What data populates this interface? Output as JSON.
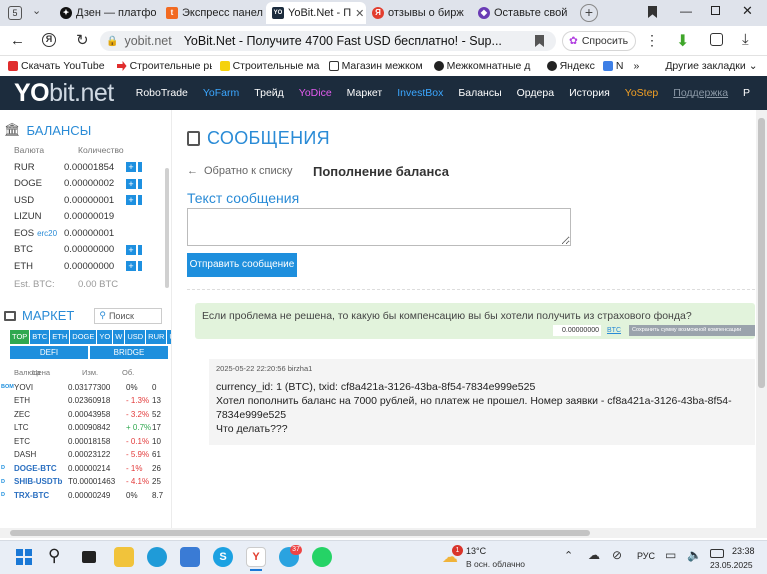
{
  "browser": {
    "tab_count": "5",
    "tabs": [
      {
        "label": "Дзен — платфо"
      },
      {
        "label": "Экспресс панел"
      },
      {
        "label": "YoBit.Net - П"
      },
      {
        "label": "отзывы о бирж"
      },
      {
        "label": "Оставьте свой"
      }
    ],
    "url": "yobit.net",
    "page_title": "YoBit.Net - Получите 4700 Fast USD бесплатно! - Sup...",
    "ask_button": "Спросить",
    "bookmarks": [
      "Скачать YouTube",
      "Строительные ры",
      "Строительные ма",
      "Магазин межком",
      "Межкомнатные д",
      "Яндекс",
      "N"
    ],
    "other_bookmarks": "Другие закладки"
  },
  "site": {
    "logo_main": "YO",
    "logo_rest": "bit.net",
    "nav": [
      {
        "label": "RoboTrade",
        "color": "#ffffff"
      },
      {
        "label": "YoFarm",
        "color": "#3ba7ff"
      },
      {
        "label": "Трейд",
        "color": "#ffffff"
      },
      {
        "label": "YoDice",
        "color": "#e45cf0"
      },
      {
        "label": "Маркет",
        "color": "#ffffff"
      },
      {
        "label": "InvestBox",
        "color": "#3ba7ff"
      },
      {
        "label": "Балансы",
        "color": "#ffffff"
      },
      {
        "label": "Ордера",
        "color": "#ffffff"
      },
      {
        "label": "История",
        "color": "#ffffff"
      },
      {
        "label": "YoStep",
        "color": "#f2a024"
      },
      {
        "label": "Поддержка",
        "color": "#8b98a6"
      },
      {
        "label": "P",
        "color": "#ffffff"
      }
    ]
  },
  "balances": {
    "title": "БАЛАНСЫ",
    "col_currency": "Валюта",
    "col_amount": "Количество",
    "rows": [
      {
        "currency": "RUR",
        "tag": "",
        "amount": "0.00001854",
        "buttons": true
      },
      {
        "currency": "DOGE",
        "tag": "",
        "amount": "0.00000002",
        "buttons": true
      },
      {
        "currency": "USD",
        "tag": "",
        "amount": "0.00000001",
        "buttons": true
      },
      {
        "currency": "LIZUN",
        "tag": "",
        "amount": "0.00000019",
        "buttons": false
      },
      {
        "currency": "EOS",
        "tag": "erc20",
        "amount": "0.00000001",
        "buttons": false
      },
      {
        "currency": "BTC",
        "tag": "",
        "amount": "0.00000000",
        "buttons": true
      },
      {
        "currency": "ETH",
        "tag": "",
        "amount": "0.00000000",
        "buttons": true
      }
    ],
    "est_label": "Est. BTC:",
    "est_value": "0.00 BTC"
  },
  "market": {
    "title": "МАРКЕТ",
    "search_placeholder": "Поиск",
    "filters": [
      "TOP",
      "BTC",
      "ETH",
      "DOGE",
      "YO",
      "W",
      "USD",
      "RUR",
      "USDT"
    ],
    "defi": "DEFI",
    "bridge": "BRIDGE",
    "col_currency": "Валюта",
    "col_price": "Цена",
    "col_change": "Изм.",
    "col_volume": "Об.",
    "rows": [
      {
        "prefix": "BOM",
        "name": "YOVI",
        "price": "0.03177300",
        "change": "0%",
        "volume": "0",
        "change_color": "#333333",
        "link": false
      },
      {
        "prefix": "",
        "name": "ETH",
        "price": "0.02360918",
        "change": "- 1.3%",
        "volume": "13",
        "change_color": "#e33b3b",
        "link": false
      },
      {
        "prefix": "",
        "name": "ZEC",
        "price": "0.00043958",
        "change": "- 3.2%",
        "volume": "52",
        "change_color": "#e33b3b",
        "link": false
      },
      {
        "prefix": "",
        "name": "LTC",
        "price": "0.00090842",
        "change": "+ 0.7%",
        "volume": "17",
        "change_color": "#2fa84f",
        "link": false
      },
      {
        "prefix": "",
        "name": "ETC",
        "price": "0.00018158",
        "change": "- 0.1%",
        "volume": "10",
        "change_color": "#e33b3b",
        "link": false
      },
      {
        "prefix": "",
        "name": "DASH",
        "price": "0.00023122",
        "change": "- 5.9%",
        "volume": "61",
        "change_color": "#e33b3b",
        "link": false
      },
      {
        "prefix": "D",
        "name": "DOGE-BTC",
        "price": "0.00000214",
        "change": "- 1%",
        "volume": "26",
        "change_color": "#e33b3b",
        "link": true
      },
      {
        "prefix": "D",
        "name": "SHIB-USDTb",
        "price": "T0.00001463",
        "change": "- 4.1%",
        "volume": "25",
        "change_color": "#e33b3b",
        "link": true
      },
      {
        "prefix": "D",
        "name": "TRX-BTC",
        "price": "0.00000249",
        "change": "0%",
        "volume": "8.7",
        "change_color": "#333333",
        "link": true
      }
    ]
  },
  "messages": {
    "title": "СООБЩЕНИЯ",
    "back_label": "Обратно к списку",
    "subject": "Пополнение баланса",
    "text_label": "Текст сообщения",
    "textarea_value": "",
    "send_button": "Отправить сообщение",
    "insurance_question": "Если проблема не решена, то какую бы компенсацию вы бы хотели получить из страхового фонда?",
    "insurance_amount": "0.00000000",
    "insurance_currency": "BTC",
    "insurance_button": "Сохранить сумму возможной компенсации",
    "message_meta": "2025-05-22 22:20:56 birzha1",
    "message_lines": [
      "currency_id: 1 (BTC), txid: cf8a421a-3126-43ba-8f54-7834e999e525",
      "Хотел пополнить баланс на 7000 рублей, но платеж не прошел. Номер заявки - cf8a421a-3126-43ba-8f54-7834e999e525",
      "Что делать???"
    ]
  },
  "taskbar": {
    "weather_temp": "13°C",
    "weather_desc": "В осн. облачно",
    "weather_badge": "1",
    "lang": "РУС",
    "time": "23:38",
    "date": "23.05.2025",
    "tg_badge": "37"
  }
}
